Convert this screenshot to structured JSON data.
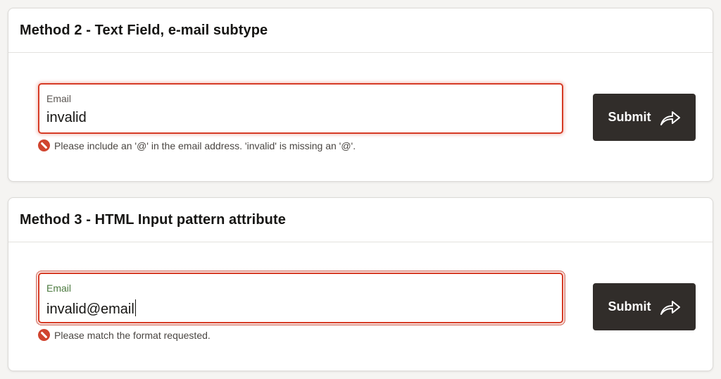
{
  "sections": [
    {
      "title": "Method 2 - Text Field, e-mail subtype",
      "field_label": "Email",
      "field_value": "invalid",
      "error_message": "Please include an '@' in the email address. 'invalid' is missing an '@'.",
      "submit_label": "Submit",
      "submit_icon": "share-arrow-icon",
      "error_icon": "error-circle-icon"
    },
    {
      "title": "Method 3 - HTML Input pattern attribute",
      "field_label": "Email",
      "field_value": "invalid@email",
      "error_message": "Please match the format requested.",
      "submit_label": "Submit",
      "submit_icon": "share-arrow-icon",
      "error_icon": "error-circle-icon"
    }
  ],
  "colors": {
    "error": "#d63b25",
    "button_bg": "#312d2a",
    "label_focused": "#4c7a3f"
  }
}
